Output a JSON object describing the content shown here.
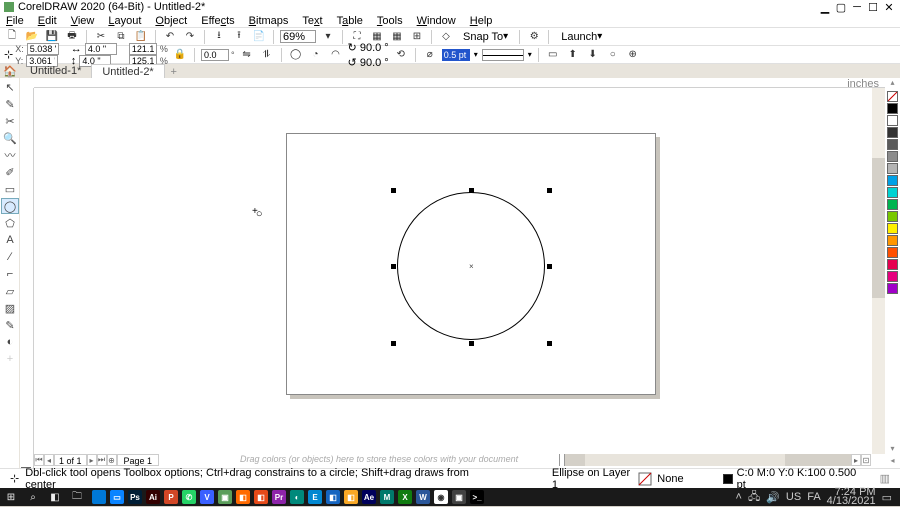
{
  "title_bar": {
    "title": "CorelDRAW 2020 (64-Bit) - Untitled-2*"
  },
  "menu": {
    "file": "File",
    "edit": "Edit",
    "view": "View",
    "layout": "Layout",
    "object": "Object",
    "effects": "Effects",
    "bitmaps": "Bitmaps",
    "text": "Text",
    "table": "Table",
    "tools": "Tools",
    "window": "Window",
    "help": "Help"
  },
  "toolbar1": {
    "zoom": "69%",
    "snap": "Snap To",
    "launch": "Launch"
  },
  "prop_bar": {
    "x_label": "X:",
    "x": "5.038 \"",
    "y_label": "Y:",
    "y": "3.061 \"",
    "w": "4.0 \"",
    "h": "4.0 \"",
    "sw": "121.1",
    "sh": "125.1",
    "percent": "%",
    "rot1_label": "90.0 °",
    "rot2_label": "90.0 °",
    "outline_width": "0.5 pt"
  },
  "tabs": {
    "t1": "Untitled-1*",
    "t2": "Untitled-2*"
  },
  "ruler": {
    "unit": "inches"
  },
  "page_nav": {
    "counter": "1 of 1",
    "page_label": "Page 1"
  },
  "docker_hint": "Drag colors (or objects) here to store these colors with your document",
  "status": {
    "hint": "Dbl-click tool opens Toolbox options; Ctrl+drag constrains to a circle; Shift+drag draws from center",
    "object": "Ellipse on Layer 1",
    "fill_label": "None",
    "outline_info": "C:0 M:0 Y:0 K:100  0.500 pt"
  },
  "palette_colors": [
    "#000000",
    "#ffffff",
    "#323232",
    "#5a5a5a",
    "#8c8c8c",
    "#b4b4b4",
    "#00a0e6",
    "#00d2d2",
    "#00b450",
    "#78c800",
    "#fff000",
    "#ff9600",
    "#ff5000",
    "#e60050",
    "#e6007e",
    "#a000c8"
  ],
  "systray": {
    "lang": "FA",
    "misc": "US",
    "time": "7:24 PM",
    "date": "4/13/2021"
  },
  "task_apps": [
    {
      "bg": "#0078d7",
      "t": ""
    },
    {
      "bg": "#0a84ff",
      "t": "▭"
    },
    {
      "bg": "#001e36",
      "t": "Ps"
    },
    {
      "bg": "#330000",
      "t": "Ai"
    },
    {
      "bg": "#d24726",
      "t": "P"
    },
    {
      "bg": "#25d366",
      "t": "✆"
    },
    {
      "bg": "#3a60ff",
      "t": "V"
    },
    {
      "bg": "#5a9e5a",
      "t": "▣"
    },
    {
      "bg": "#ff6a00",
      "t": "◧"
    },
    {
      "bg": "#e64a19",
      "t": "◧"
    },
    {
      "bg": "#8e24aa",
      "t": "Pr"
    },
    {
      "bg": "#00897b",
      "t": "◐"
    },
    {
      "bg": "#0288d1",
      "t": "E"
    },
    {
      "bg": "#1565c0",
      "t": "◧"
    },
    {
      "bg": "#f9a825",
      "t": "◧"
    },
    {
      "bg": "#00005b",
      "t": "Ae"
    },
    {
      "bg": "#00796b",
      "t": "M"
    },
    {
      "bg": "#107c10",
      "t": "X"
    },
    {
      "bg": "#2b579a",
      "t": "W"
    },
    {
      "bg": "#ffffff",
      "t": "◉"
    },
    {
      "bg": "#424242",
      "t": "▣"
    },
    {
      "bg": "#000000",
      "t": ">_"
    }
  ]
}
